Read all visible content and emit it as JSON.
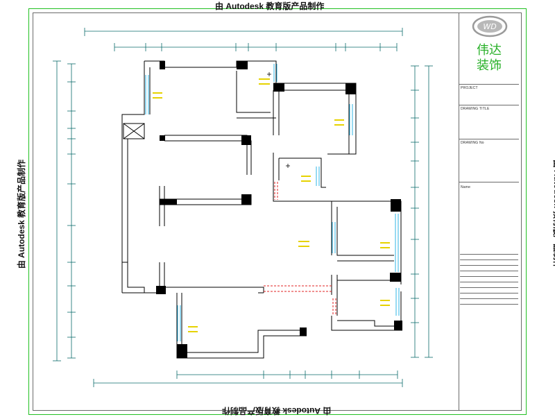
{
  "watermark": {
    "text": "由 Autodesk 教育版产品制作"
  },
  "title_block": {
    "brand": "伟达装饰",
    "brand_line1": "伟达",
    "brand_line2": "装饰",
    "project_label": "PROJECT",
    "drawing_title_label": "DRAWING TITLE",
    "drawing_no_label": "DRAWING No",
    "name_label": "Name"
  },
  "colors": {
    "frame": "#21c021",
    "walls": "#000000",
    "dimension": "#0a6a6a",
    "window": "#2fb6e6",
    "door_dashed": "#e02020",
    "room_label": "#e6d200",
    "brand": "#27b027"
  },
  "icons": [
    "logo-emblem-icon",
    "ventilation-shaft-icon"
  ]
}
